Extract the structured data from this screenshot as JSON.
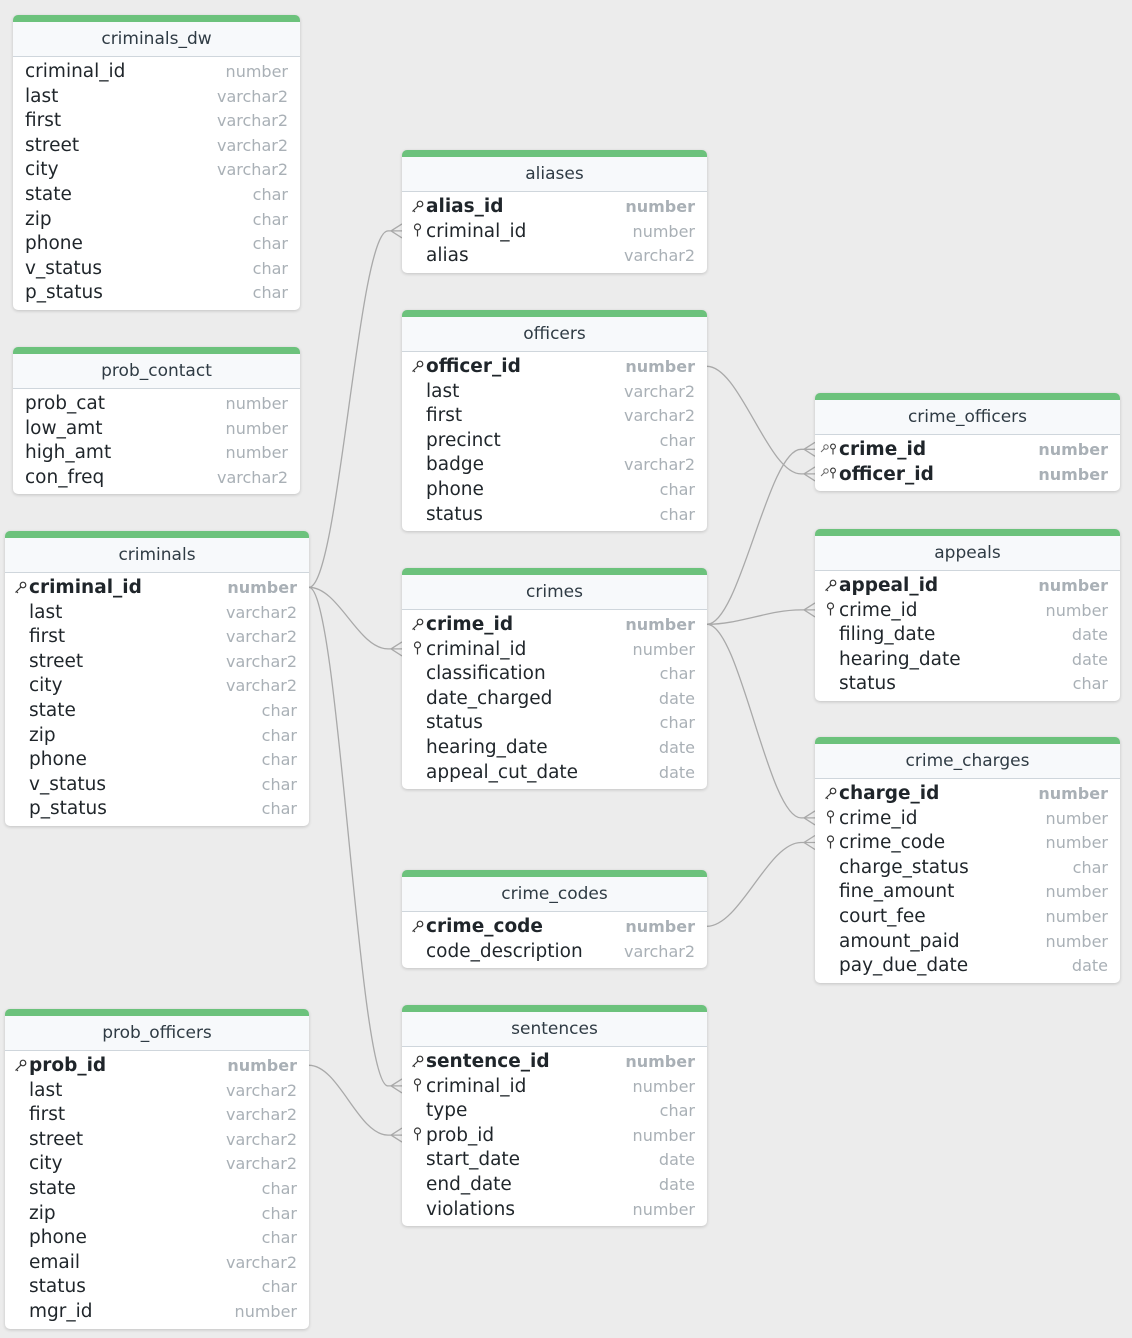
{
  "tables": [
    {
      "id": "criminals_dw",
      "title": "criminals_dw",
      "cols": [
        {
          "n": "criminal_id",
          "t": "number"
        },
        {
          "n": "last",
          "t": "varchar2"
        },
        {
          "n": "first",
          "t": "varchar2"
        },
        {
          "n": "street",
          "t": "varchar2"
        },
        {
          "n": "city",
          "t": "varchar2"
        },
        {
          "n": "state",
          "t": "char"
        },
        {
          "n": "zip",
          "t": "char"
        },
        {
          "n": "phone",
          "t": "char"
        },
        {
          "n": "v_status",
          "t": "char"
        },
        {
          "n": "p_status",
          "t": "char"
        }
      ]
    },
    {
      "id": "prob_contact",
      "title": "prob_contact",
      "cols": [
        {
          "n": "prob_cat",
          "t": "number"
        },
        {
          "n": "low_amt",
          "t": "number"
        },
        {
          "n": "high_amt",
          "t": "number"
        },
        {
          "n": "con_freq",
          "t": "varchar2"
        }
      ]
    },
    {
      "id": "criminals",
      "title": "criminals",
      "cols": [
        {
          "n": "criminal_id",
          "t": "number",
          "pk": true
        },
        {
          "n": "last",
          "t": "varchar2"
        },
        {
          "n": "first",
          "t": "varchar2"
        },
        {
          "n": "street",
          "t": "varchar2"
        },
        {
          "n": "city",
          "t": "varchar2"
        },
        {
          "n": "state",
          "t": "char"
        },
        {
          "n": "zip",
          "t": "char"
        },
        {
          "n": "phone",
          "t": "char"
        },
        {
          "n": "v_status",
          "t": "char"
        },
        {
          "n": "p_status",
          "t": "char"
        }
      ]
    },
    {
      "id": "prob_officers",
      "title": "prob_officers",
      "cols": [
        {
          "n": "prob_id",
          "t": "number",
          "pk": true
        },
        {
          "n": "last",
          "t": "varchar2"
        },
        {
          "n": "first",
          "t": "varchar2"
        },
        {
          "n": "street",
          "t": "varchar2"
        },
        {
          "n": "city",
          "t": "varchar2"
        },
        {
          "n": "state",
          "t": "char"
        },
        {
          "n": "zip",
          "t": "char"
        },
        {
          "n": "phone",
          "t": "char"
        },
        {
          "n": "email",
          "t": "varchar2"
        },
        {
          "n": "status",
          "t": "char"
        },
        {
          "n": "mgr_id",
          "t": "number"
        }
      ]
    },
    {
      "id": "aliases",
      "title": "aliases",
      "cols": [
        {
          "n": "alias_id",
          "t": "number",
          "pk": true
        },
        {
          "n": "criminal_id",
          "t": "number",
          "fk": true
        },
        {
          "n": "alias",
          "t": "varchar2"
        }
      ]
    },
    {
      "id": "officers",
      "title": "officers",
      "cols": [
        {
          "n": "officer_id",
          "t": "number",
          "pk": true
        },
        {
          "n": "last",
          "t": "varchar2"
        },
        {
          "n": "first",
          "t": "varchar2"
        },
        {
          "n": "precinct",
          "t": "char"
        },
        {
          "n": "badge",
          "t": "varchar2"
        },
        {
          "n": "phone",
          "t": "char"
        },
        {
          "n": "status",
          "t": "char"
        }
      ]
    },
    {
      "id": "crimes",
      "title": "crimes",
      "cols": [
        {
          "n": "crime_id",
          "t": "number",
          "pk": true
        },
        {
          "n": "criminal_id",
          "t": "number",
          "fk": true
        },
        {
          "n": "classification",
          "t": "char"
        },
        {
          "n": "date_charged",
          "t": "date"
        },
        {
          "n": "status",
          "t": "char"
        },
        {
          "n": "hearing_date",
          "t": "date"
        },
        {
          "n": "appeal_cut_date",
          "t": "date"
        }
      ]
    },
    {
      "id": "crime_codes",
      "title": "crime_codes",
      "cols": [
        {
          "n": "crime_code",
          "t": "number",
          "pk": true
        },
        {
          "n": "code_description",
          "t": "varchar2"
        }
      ]
    },
    {
      "id": "sentences",
      "title": "sentences",
      "cols": [
        {
          "n": "sentence_id",
          "t": "number",
          "pk": true
        },
        {
          "n": "criminal_id",
          "t": "number",
          "fk": true
        },
        {
          "n": "type",
          "t": "char"
        },
        {
          "n": "prob_id",
          "t": "number",
          "fk": true
        },
        {
          "n": "start_date",
          "t": "date"
        },
        {
          "n": "end_date",
          "t": "date"
        },
        {
          "n": "violations",
          "t": "number"
        }
      ]
    },
    {
      "id": "crime_officers",
      "title": "crime_officers",
      "cols": [
        {
          "n": "crime_id",
          "t": "number",
          "pk": true,
          "fk": true
        },
        {
          "n": "officer_id",
          "t": "number",
          "pk": true,
          "fk": true
        }
      ]
    },
    {
      "id": "appeals",
      "title": "appeals",
      "cols": [
        {
          "n": "appeal_id",
          "t": "number",
          "pk": true
        },
        {
          "n": "crime_id",
          "t": "number",
          "fk": true
        },
        {
          "n": "filing_date",
          "t": "date"
        },
        {
          "n": "hearing_date",
          "t": "date"
        },
        {
          "n": "status",
          "t": "char"
        }
      ]
    },
    {
      "id": "crime_charges",
      "title": "crime_charges",
      "cols": [
        {
          "n": "charge_id",
          "t": "number",
          "pk": true
        },
        {
          "n": "crime_id",
          "t": "number",
          "fk": true
        },
        {
          "n": "crime_code",
          "t": "number",
          "fk": true
        },
        {
          "n": "charge_status",
          "t": "char"
        },
        {
          "n": "fine_amount",
          "t": "number"
        },
        {
          "n": "court_fee",
          "t": "number"
        },
        {
          "n": "amount_paid",
          "t": "number"
        },
        {
          "n": "pay_due_date",
          "t": "date"
        }
      ]
    }
  ],
  "relations": [
    {
      "from": "criminals.criminal_id",
      "to": "aliases.criminal_id"
    },
    {
      "from": "criminals.criminal_id",
      "to": "crimes.criminal_id"
    },
    {
      "from": "criminals.criminal_id",
      "to": "sentences.criminal_id"
    },
    {
      "from": "prob_officers.prob_id",
      "to": "sentences.prob_id"
    },
    {
      "from": "officers.officer_id",
      "to": "crime_officers.officer_id"
    },
    {
      "from": "crimes.crime_id",
      "to": "crime_officers.crime_id"
    },
    {
      "from": "crimes.crime_id",
      "to": "appeals.crime_id"
    },
    {
      "from": "crimes.crime_id",
      "to": "crime_charges.crime_id"
    },
    {
      "from": "crime_codes.crime_code",
      "to": "crime_charges.crime_code"
    }
  ],
  "colors": {
    "header_accent": "#6cc27c",
    "background": "#ececec",
    "link": "#a9a9a9"
  }
}
